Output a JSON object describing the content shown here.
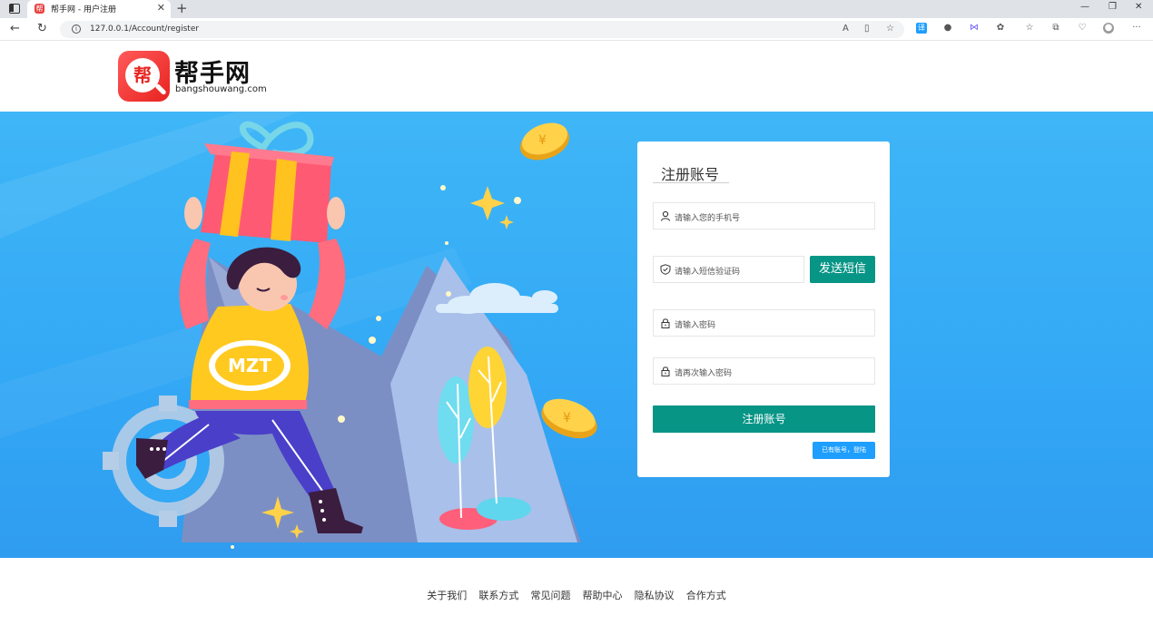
{
  "browser": {
    "tab_title": "帮手网 - 用户注册",
    "favicon_text": "帮",
    "url": "127.0.0.1/Account/register"
  },
  "header": {
    "logo_char": "帮",
    "logo_name": "帮手网",
    "logo_domain": "bangshouwang.com"
  },
  "illustration": {
    "shirt_text": "MZT"
  },
  "register": {
    "title": "注册账号",
    "phone_placeholder": "请输入您的手机号",
    "sms_code_placeholder": "请输入短信验证码",
    "send_sms_label": "发送短信",
    "password_placeholder": "请输入密码",
    "confirm_password_placeholder": "请再次输入密码",
    "submit_label": "注册账号",
    "login_link": "已有账号，登陆"
  },
  "footer": {
    "links": [
      "关于我们",
      "联系方式",
      "常见问题",
      "帮助中心",
      "隐私协议",
      "合作方式"
    ]
  },
  "colors": {
    "primary_button": "#079586",
    "banner_blue": "#35aaf5",
    "login_link_blue": "#1e9fff",
    "logo_red": "#e8231f"
  }
}
